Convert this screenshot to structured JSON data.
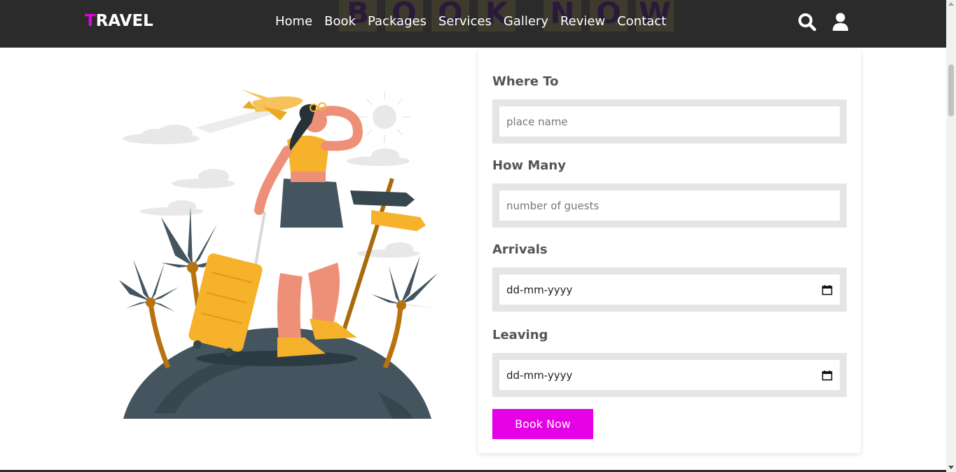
{
  "header": {
    "logo_first_letter": "T",
    "logo_rest": "RAVEL",
    "background_heading": [
      "B",
      "O",
      "O",
      "K",
      "N",
      "O",
      "W"
    ],
    "nav": [
      "Home",
      "Book",
      "Packages",
      "Services",
      "Gallery",
      "Review",
      "Contact"
    ],
    "icons": [
      "search-icon",
      "user-icon"
    ]
  },
  "form": {
    "where_label": "Where To",
    "where_placeholder": "place name",
    "howmany_label": "How Many",
    "howmany_placeholder": "number of guests",
    "arrivals_label": "Arrivals",
    "arrivals_value": "dd-mm-yyyy",
    "leaving_label": "Leaving",
    "leaving_value": "dd-mm-yyyy",
    "submit_label": "Book Now"
  },
  "colors": {
    "accent": "#e600e6",
    "header_bg": "#2b2b2b",
    "field_bg": "#e5e5e5"
  }
}
